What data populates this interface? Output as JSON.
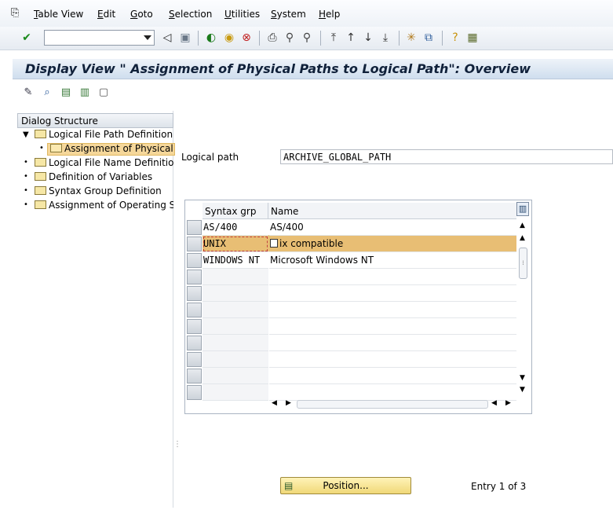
{
  "menubar": {
    "items": [
      {
        "label": "Table View",
        "underline": "T",
        "rest": "able View"
      },
      {
        "label": "Edit",
        "underline": "E",
        "rest": "dit"
      },
      {
        "label": "Goto",
        "underline": "G",
        "rest": "oto"
      },
      {
        "label": "Selection",
        "underline": "S",
        "rest": "election"
      },
      {
        "label": "Utilities",
        "underline": "U",
        "rest": "tilities"
      },
      {
        "label": "System",
        "underline": "S",
        "rest": "ystem"
      },
      {
        "label": "Help",
        "underline": "H",
        "rest": "elp"
      }
    ]
  },
  "toolbar": {
    "command_field_value": "",
    "icons": [
      "enter-icon",
      "back-icon",
      "exit-icon",
      "cancel-icon",
      "print-icon",
      "find-icon",
      "find-next-icon",
      "first-page-icon",
      "prev-page-icon",
      "next-page-icon",
      "last-page-icon",
      "new-session-icon",
      "shortcut-icon",
      "help-icon",
      "layout-icon"
    ]
  },
  "title": "Display View \" Assignment of Physical Paths to Logical Path\": Overview",
  "app_toolbar_icons": [
    "display-change-icon",
    "details-icon",
    "select-all-icon",
    "select-block-icon",
    "deselect-all-icon"
  ],
  "tree": {
    "header": "Dialog Structure",
    "nodes": [
      {
        "label": "Logical File Path Definition",
        "expanded": true
      },
      {
        "label": "Assignment of Physical Paths to Logical Path",
        "selected": true
      },
      {
        "label": "Logical File Name Definition, Cross-Client"
      },
      {
        "label": "Definition of Variables"
      },
      {
        "label": "Syntax Group Definition"
      },
      {
        "label": "Assignment of Operating System to Syntax Group"
      }
    ]
  },
  "form": {
    "logical_path_label": "Logical path",
    "logical_path_value": "ARCHIVE_GLOBAL_PATH"
  },
  "table": {
    "columns": [
      "Syntax grp",
      "Name"
    ],
    "rows": [
      {
        "syntax": "AS/400",
        "name": "AS/400"
      },
      {
        "syntax": "UNIX",
        "name": "Unix compatible",
        "name_visible": "ix compatible",
        "selected": true
      },
      {
        "syntax": "WINDOWS NT",
        "name": "Microsoft Windows NT"
      }
    ],
    "empty_rows": 8
  },
  "footer": {
    "position_button": "Position...",
    "entry_text": "Entry 1 of 3"
  },
  "colors": {
    "selected_row": "#e8be74",
    "title_text": "#10213a",
    "button_fill": "#f6e49c"
  }
}
